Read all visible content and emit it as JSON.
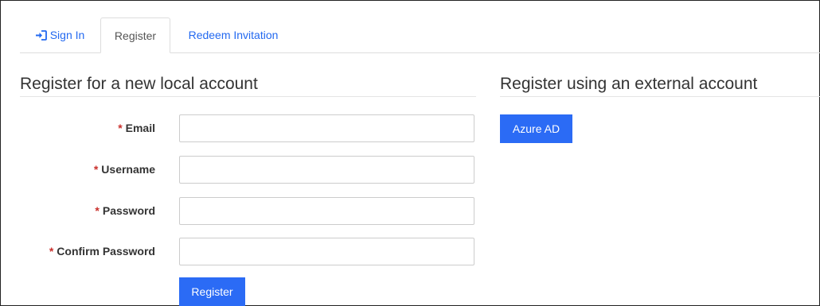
{
  "tabs": [
    {
      "label": "Sign In",
      "icon": "sign-in-icon"
    },
    {
      "label": "Register",
      "active": true
    },
    {
      "label": "Redeem Invitation"
    }
  ],
  "local": {
    "title": "Register for a new local account",
    "required_marker": "*",
    "fields": [
      {
        "label": "Email",
        "value": "",
        "placeholder": ""
      },
      {
        "label": "Username",
        "value": "",
        "placeholder": ""
      },
      {
        "label": "Password",
        "value": "",
        "placeholder": ""
      },
      {
        "label": "Confirm Password",
        "value": "",
        "placeholder": ""
      }
    ],
    "submit_label": "Register"
  },
  "external": {
    "title": "Register using an external account",
    "providers": [
      {
        "label": "Azure AD"
      }
    ]
  },
  "colors": {
    "link": "#2369f0",
    "primary_button": "#2b6bf5",
    "required": "#c9302c"
  }
}
